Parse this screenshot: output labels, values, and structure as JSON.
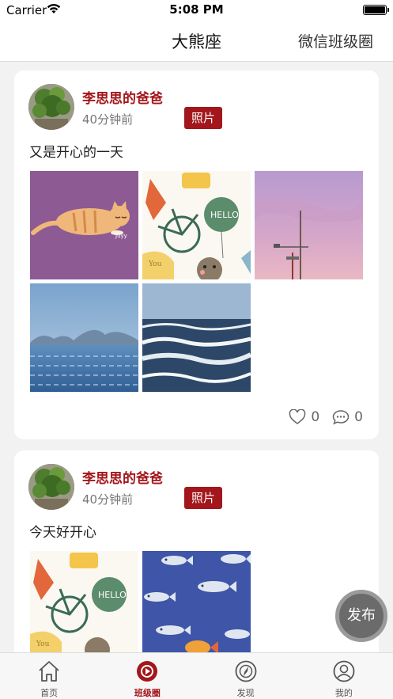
{
  "status_bar": {
    "carrier": "Carrier",
    "time": "5:08 PM"
  },
  "nav": {
    "title": "大熊座",
    "right_link": "微信班级圈"
  },
  "posts": [
    {
      "author": "李思思的爸爸",
      "time": "40分钟前",
      "tag": "照片",
      "text": "又是开心的一天",
      "images": [
        "sleeping-cat-illustration",
        "bear-bicycle-illustration",
        "pink-sky-antenna-photo",
        "lake-mountains-photo",
        "ocean-waves-photo"
      ],
      "likes": "0",
      "comments": "0"
    },
    {
      "author": "李思思的爸爸",
      "time": "40分钟前",
      "tag": "照片",
      "text": "今天好开心",
      "images": [
        "bear-bicycle-illustration",
        "fish-pattern-illustration"
      ]
    }
  ],
  "fab": {
    "label": "发布"
  },
  "tabs": [
    {
      "label": "首页",
      "icon": "home-icon"
    },
    {
      "label": "班级圈",
      "icon": "class-circle-icon",
      "active": true
    },
    {
      "label": "发现",
      "icon": "discover-icon"
    },
    {
      "label": "我的",
      "icon": "profile-icon"
    }
  ],
  "colors": {
    "accent": "#a3161b",
    "background": "#f2f2f2"
  }
}
